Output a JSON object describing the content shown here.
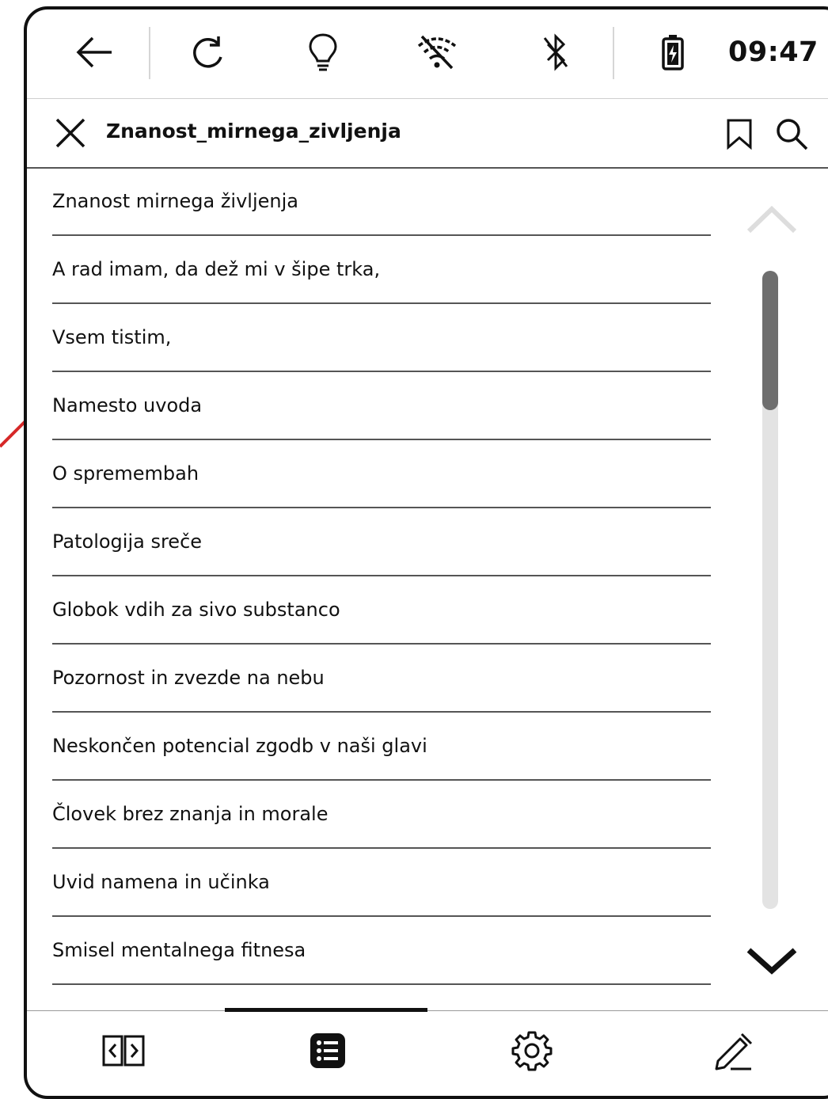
{
  "status_bar": {
    "time": "09:47",
    "icons": [
      "back-arrow-icon",
      "refresh-icon",
      "frontlight-bulb-icon",
      "wifi-off-icon",
      "bluetooth-off-icon",
      "battery-charging-icon"
    ]
  },
  "header": {
    "title": "Znanost_mirnega_zivljenja",
    "icons": [
      "close-icon",
      "bookmark-icon",
      "search-icon"
    ]
  },
  "toc": {
    "items": [
      "Znanost mirnega življenja",
      "A rad imam, da dež mi v šipe trka,",
      "Vsem tistim,",
      "Namesto uvoda",
      "O spremembah",
      "Patologija sreče",
      "Globok vdih za sivo substanco",
      "Pozornost in zvezde na nebu",
      "Neskončen potencial zgodb v naši glavi",
      "Človek brez znanja in morale",
      "Uvid namena in učinka",
      "Smisel mentalnega fitnesa"
    ],
    "scroll_position": 0.0
  },
  "bottom_bar": {
    "tabs": [
      "reading-view-icon",
      "table-of-contents-icon",
      "settings-gear-icon",
      "annotate-pen-icon"
    ],
    "active_tab": "table-of-contents-icon"
  },
  "colors": {
    "annotation_arrow": "#d62828",
    "scroll_thumb": "#6e6e6e",
    "scroll_track": "#e3e3e3"
  }
}
